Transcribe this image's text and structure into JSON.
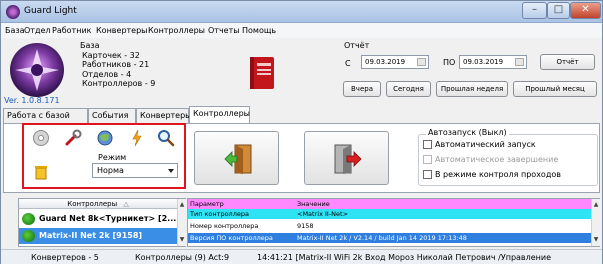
{
  "window": {
    "title": "Guard Light"
  },
  "menu": [
    "База",
    "Отдел",
    "Работник",
    "Конвертеры",
    "Контроллеры",
    "Отчеты",
    "Помощь"
  ],
  "info": {
    "base_label": "База",
    "cards": "Карточек - 32",
    "workers": "Работников - 21",
    "departments": "Отделов - 4",
    "controllers": "Контроллеров - 9"
  },
  "version": "Ver. 1.0.8.171",
  "report": {
    "label": "Отчёт",
    "from_label": "С",
    "from_date": "09.03.2019",
    "to_label": "ПО",
    "to_date": "09.03.2019",
    "report_button": "Отчёт",
    "yesterday": "Вчера",
    "today": "Сегодня",
    "last_week": "Прошлая неделя",
    "last_month": "Прошлый месяц"
  },
  "tabs": [
    "Работа с базой",
    "События",
    "Конвертеры",
    "Контроллеры"
  ],
  "active_tab": 3,
  "tools": {
    "mode_label": "Режим",
    "mode_value": "Норма"
  },
  "autostart": {
    "legend": "Автозапуск (Выкл)",
    "options": [
      {
        "label": "Автоматический запуск",
        "checked": false,
        "enabled": true
      },
      {
        "label": "Автоматическое завершение",
        "checked": false,
        "enabled": false
      },
      {
        "label": "В режиме контроля проходов",
        "checked": false,
        "enabled": true
      }
    ]
  },
  "controllers_list": {
    "header": "Контроллеры",
    "sort_glyph": "△",
    "items": [
      {
        "label": "Guard Net 8k<Турникет> [2...",
        "selected": false
      },
      {
        "label": "Matrix-II Net 2k [9158]",
        "selected": true
      }
    ]
  },
  "params": {
    "headers": [
      "Параметр",
      "Значение"
    ],
    "rows": [
      {
        "param": "Тип контроллера",
        "value": "<Matrix II-Net>",
        "style": "cyan"
      },
      {
        "param": "Номер контроллера",
        "value": "9158",
        "style": "white"
      },
      {
        "param": "Версия ПО контроллера",
        "value": "Matrix-II Net 2k / V2.14 / build Jan 14 2019 17:13:48",
        "style": "blue"
      }
    ]
  },
  "status": {
    "converters": "Конвертеров - 5",
    "controllers": "Контроллеры (9) Act:9",
    "event": "14:41:21 [Matrix-II WiFi 2k Вход Мороз Николай Петрович /Управление"
  },
  "colors": {
    "highlight_red": "#e0141e",
    "row_cyan": "#2ee4f4",
    "row_pink": "#ff88ff",
    "row_blue": "#2f7fe0"
  }
}
